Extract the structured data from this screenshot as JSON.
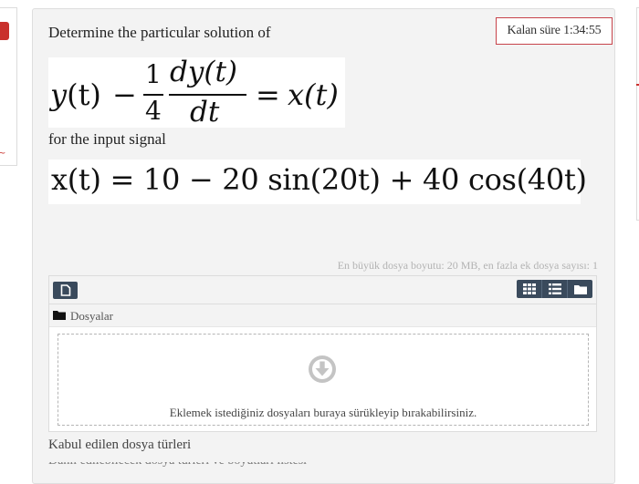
{
  "timer": {
    "label": "Kalan süre 1:34:55"
  },
  "question": {
    "title": "Determine the particular solution of",
    "equation1": {
      "lhs_y": "y",
      "paren_t": "(t)",
      "minus": "−",
      "frac_num": "1",
      "frac_den": "4",
      "deriv_num": "dy(t)",
      "deriv_den": "dt",
      "equals": "=",
      "rhs": "x(t)"
    },
    "for_label": "for  the input signal",
    "equation2": "x(t) = 10 − 20 sin(20t) + 40 cos(40t)"
  },
  "filepicker": {
    "max_info": "En büyük dosya boyutu: 20 MB, en fazla ek dosya sayısı: 1",
    "add_icon": "file-icon",
    "views": [
      "grid-view-icon",
      "list-view-icon",
      "folder-view-icon"
    ],
    "path_label": "Dosyalar",
    "drop_hint": "Eklemek istediğiniz dosyaları buraya sürükleyip bırakabilirsiniz."
  },
  "accepted_types_label": "Kabul edilen dosya türleri",
  "colors": {
    "accent_red": "#c7434a",
    "button_dark": "#3a4a5c",
    "panel_bg": "#f3f3f3"
  }
}
